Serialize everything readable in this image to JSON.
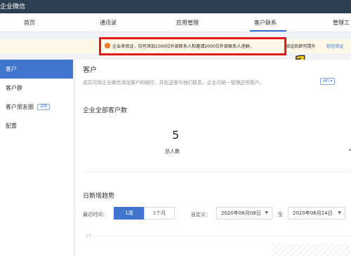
{
  "app": {
    "title": "企业微信"
  },
  "nav": {
    "items": [
      {
        "label": "首页"
      },
      {
        "label": "通讯录"
      },
      {
        "label": "应用管理"
      },
      {
        "label": "客户联系"
      },
      {
        "label": "管理工"
      }
    ],
    "active": "客户联系"
  },
  "notice": {
    "text": "企业未验证，仅可添加1000位外部联系人和邀请2000位外部联系人进群，",
    "extra": "验证后即可提升",
    "link": "前往验证"
  },
  "annotation": {
    "label": "1"
  },
  "sidebar": {
    "items": [
      {
        "label": "客户"
      },
      {
        "label": "客户群"
      },
      {
        "label": "客户朋友圈",
        "tag": "试用"
      },
      {
        "label": "配置"
      }
    ]
  },
  "main": {
    "title": "客户",
    "description": "成员可用企业微信添加客户的微信，并在这里与他们联系，企业可统一管理这些客户。",
    "api_tag": "API ▾",
    "total_section": {
      "title": "企业全部客户数",
      "value": "5",
      "label": "总人数",
      "partial_mark": "<"
    },
    "trend": {
      "title": "日新增趋势",
      "recent_label": "最近时间：",
      "segments": [
        "1周",
        "1个月"
      ],
      "custom_label": "自定义：",
      "start_date": "2020年06月08日",
      "to_label": "至",
      "end_date": "2020年06月14日",
      "axis_tick": "10"
    }
  },
  "colors": {
    "topbar": "#2c3e52",
    "accent": "#3f75cc",
    "warning_bg": "#fdf7e7",
    "highlight_box": "#e21b1b",
    "annotation": "#f1c40f"
  }
}
